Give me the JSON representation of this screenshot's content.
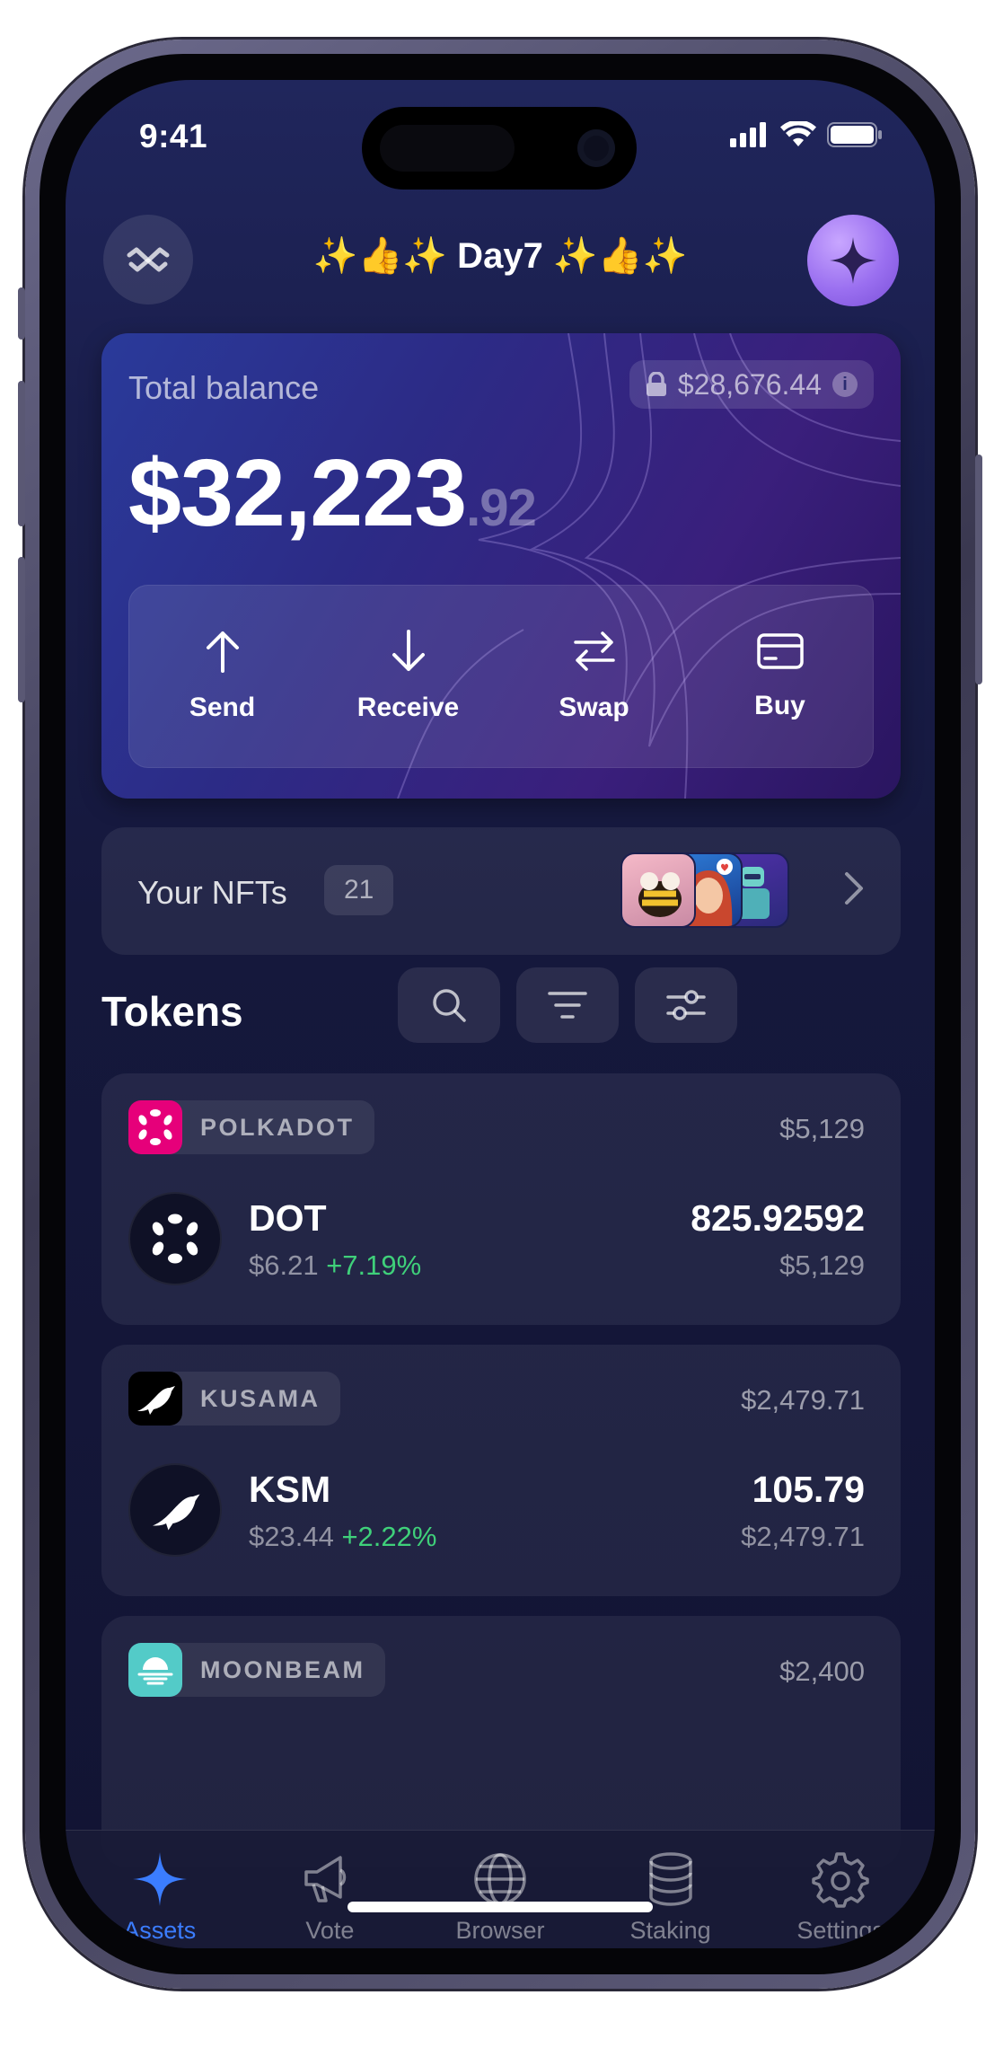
{
  "status_bar": {
    "time": "9:41"
  },
  "header": {
    "title": "✨👍✨ Day7 ✨👍✨",
    "left_icon": "walletconnect-icon",
    "right_icon": "sparkle-avatar-icon"
  },
  "balance": {
    "label": "Total balance",
    "locked_amount": "$28,676.44",
    "info_glyph": "i",
    "amount_main": "$32,223",
    "amount_cents": ".92",
    "actions": [
      {
        "label": "Send",
        "icon": "arrow-up-icon"
      },
      {
        "label": "Receive",
        "icon": "arrow-down-icon"
      },
      {
        "label": "Swap",
        "icon": "swap-icon"
      },
      {
        "label": "Buy",
        "icon": "card-icon"
      }
    ]
  },
  "nfts": {
    "label": "Your NFTs",
    "count": "21"
  },
  "tokens": {
    "title": "Tokens",
    "tools": [
      "search-icon",
      "filter-icon",
      "sliders-icon"
    ],
    "items": [
      {
        "chain": "POLKADOT",
        "chain_total": "$5,129",
        "symbol": "DOT",
        "price": "$6.21",
        "change": "+7.19%",
        "amount": "825.92592",
        "value": "$5,129"
      },
      {
        "chain": "KUSAMA",
        "chain_total": "$2,479.71",
        "symbol": "KSM",
        "price": "$23.44",
        "change": "+2.22%",
        "amount": "105.79",
        "value": "$2,479.71"
      },
      {
        "chain": "MOONBEAM",
        "chain_total": "$2,400"
      }
    ]
  },
  "tabbar": {
    "items": [
      {
        "label": "Assets",
        "icon": "sparkle-icon",
        "active": true
      },
      {
        "label": "Vote",
        "icon": "megaphone-icon",
        "active": false
      },
      {
        "label": "Browser",
        "icon": "globe-icon",
        "active": false
      },
      {
        "label": "Staking",
        "icon": "coins-stack-icon",
        "active": false
      },
      {
        "label": "Settings",
        "icon": "gear-icon",
        "active": false
      }
    ]
  },
  "colors": {
    "accent": "#3b7dff",
    "positive": "#3fd07a",
    "polkadot": "#e6007a",
    "moonbeam": "#53cbc8"
  }
}
